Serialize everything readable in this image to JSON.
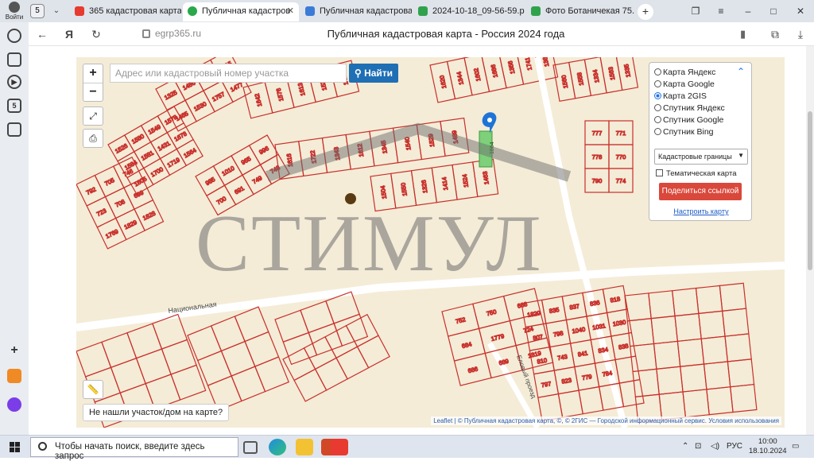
{
  "browser": {
    "profile_label": "Войти",
    "tab_count": "5",
    "tabs": [
      {
        "label": "365 кадастровая карта",
        "icon_color": "#e63b2e"
      },
      {
        "label": "Публичная кадастров",
        "icon_color": "#2aa84a"
      },
      {
        "label": "Публичная кадастрова",
        "icon_color": "#3b7bd8"
      },
      {
        "label": "2024-10-18_09-56-59.pr",
        "icon_color": "#31a24c"
      },
      {
        "label": "Фото Ботаничекая 75.pr",
        "icon_color": "#31a24c"
      }
    ],
    "new_tab": "+",
    "address": {
      "domain": "egrp365.ru",
      "page_title": "Публичная кадастровая карта - Россия 2024 года"
    }
  },
  "map": {
    "search_placeholder": "Адрес или кадастровый номер участка",
    "search_button": "Найти",
    "zoom_in": "+",
    "zoom_out": "−",
    "not_found_button": "Не нашли участок/дом на карте?",
    "attribution": "Leaflet | © Публичная кадастровая карта, ©, © 2ГИС — Городской информационный сервис. Условия использования",
    "street_label": "Национальная",
    "street_label_2": "Еловый проезд",
    "watermark": "СТИМУЛ",
    "layers": {
      "options": [
        {
          "label": "Карта Яндекс",
          "selected": false
        },
        {
          "label": "Карта Google",
          "selected": false
        },
        {
          "label": "Карта 2GIS",
          "selected": true
        },
        {
          "label": "Спутник Яндекс",
          "selected": false
        },
        {
          "label": "Спутник Google",
          "selected": false
        },
        {
          "label": "Спутник Bing",
          "selected": false
        }
      ],
      "overlay_select": "Кадастровые границы",
      "thematic_label": "Тематическая карта",
      "share_button": "Поделиться ссылкой",
      "configure_link": "Настроить карту"
    },
    "parcel_numbers": [
      "1620",
      "1344",
      "1602",
      "1686",
      "1356",
      "1741",
      "1384",
      "1560",
      "1558",
      "1334",
      "1563",
      "1335",
      "1642",
      "1576",
      "1613",
      "1525",
      "1471",
      "1325",
      "1486",
      "1424",
      "1515",
      "1465",
      "1530",
      "1757",
      "1477",
      "1526",
      "1580",
      "1549",
      "1578",
      "1584",
      "1581",
      "1431",
      "1678",
      "1605",
      "1700",
      "1719",
      "1564",
      "1616",
      "1722",
      "1343",
      "1612",
      "1345",
      "1540",
      "1529",
      "1489",
      "1504",
      "1550",
      "1326",
      "1414",
      "1524",
      "1463",
      "985",
      "1010",
      "965",
      "996",
      "700",
      "691",
      "749",
      "748",
      "792",
      "705",
      "746",
      "723",
      "708",
      "699",
      "1769",
      "1829",
      "1828",
      "777",
      "771",
      "778",
      "770",
      "790",
      "774",
      "752",
      "750",
      "688",
      "684",
      "1779",
      "724",
      "686",
      "689",
      "1819",
      "1820",
      "835",
      "837",
      "836",
      "818",
      "807",
      "798",
      "1040",
      "1031",
      "1030",
      "810",
      "743",
      "841",
      "834",
      "838",
      "797",
      "823",
      "779",
      "784"
    ],
    "highlighted_parcel": "1564"
  },
  "taskbar": {
    "search_text": "Чтобы начать поиск, введите здесь запрос",
    "language": "РУС",
    "time": "10:00",
    "date": "18.10.2024"
  }
}
